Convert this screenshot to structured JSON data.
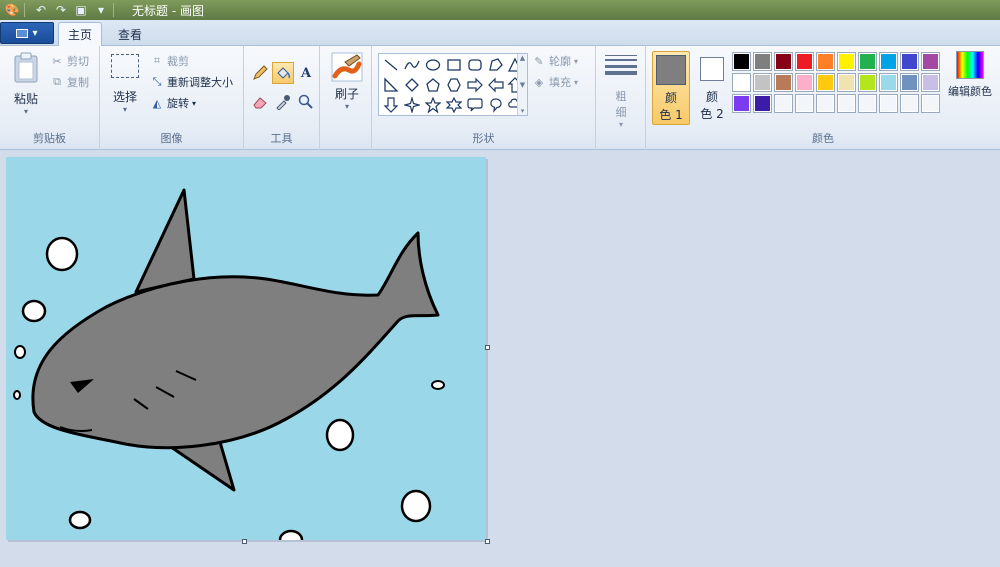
{
  "titlebar": {
    "title": "无标题 - 画图",
    "qa_icons": [
      "paint-app-icon",
      "undo-icon",
      "redo-icon",
      "save-icon",
      "customize-dropdown-icon"
    ]
  },
  "tabs": {
    "menu_button": "▾",
    "home": "主页",
    "view": "查看"
  },
  "clipboard": {
    "paste": "粘贴",
    "cut": "剪切",
    "copy": "复制",
    "label": "剪贴板"
  },
  "image": {
    "select": "选择",
    "crop": "裁剪",
    "resize": "重新调整大小",
    "rotate": "旋转",
    "label": "图像"
  },
  "tools": {
    "label": "工具",
    "selected_tool": "fill-bucket"
  },
  "brushes": {
    "label": "刷子"
  },
  "shapes": {
    "label": "形状",
    "outline": "轮廓",
    "fill": "填充"
  },
  "size": {
    "label_top": "粗",
    "label_bottom": "细"
  },
  "colors": {
    "color1_label_top": "颜",
    "color1_label_bottom": "色 1",
    "color2_label_top": "颜",
    "color2_label_bottom": "色 2",
    "color1": "#7f7f7f",
    "color2": "#ffffff",
    "edit": "编辑颜色",
    "label": "颜色",
    "palette_row1": [
      "#000000",
      "#7f7f7f",
      "#880015",
      "#ed1c24",
      "#ff7f27",
      "#fff200",
      "#22b14c",
      "#00a2e8",
      "#3f48cc",
      "#a349a4"
    ],
    "palette_row2": [
      "#ffffff",
      "#c3c3c3",
      "#b97a57",
      "#ffaec9",
      "#ffc90e",
      "#efe4b0",
      "#b5e61d",
      "#99d9ea",
      "#7092be",
      "#c8bfe7"
    ],
    "palette_row3": [
      "#7b3cf0",
      "#3a1ca8",
      "",
      "",
      "",
      "",
      "",
      "",
      "",
      ""
    ]
  },
  "canvas": {
    "background": "#9ad7e8",
    "shark_color": "#7f7f7f",
    "bubble_color": "#ffffff"
  }
}
